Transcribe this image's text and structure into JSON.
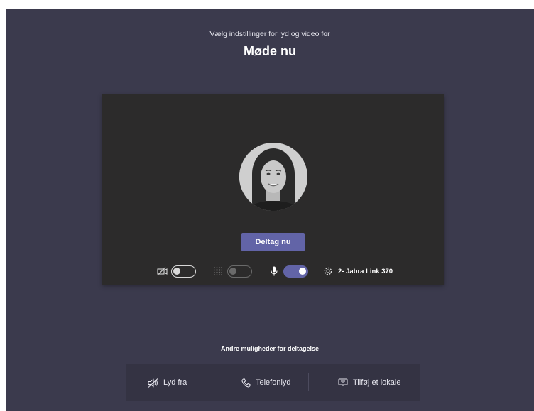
{
  "header": {
    "subtitle": "Vælg indstillinger for lyd og video for",
    "title": "Møde nu"
  },
  "preview": {
    "join_label": "Deltag nu",
    "controls": {
      "camera": {
        "icon": "camera-off-icon",
        "state": "off"
      },
      "background_blur": {
        "icon": "blur-icon",
        "state": "disabled"
      },
      "microphone": {
        "icon": "microphone-icon",
        "state": "on"
      },
      "device_settings": {
        "icon": "gear-icon",
        "label": "2- Jabra Link 370"
      }
    }
  },
  "other_options": {
    "heading": "Andre muligheder for deltagelse",
    "items": [
      {
        "icon": "speaker-off-icon",
        "label": "Lyd fra"
      },
      {
        "icon": "phone-icon",
        "label": "Telefonlyd"
      },
      {
        "icon": "room-share-icon",
        "label": "Tilføj et lokale"
      }
    ]
  },
  "colors": {
    "background": "#3b3a4d",
    "preview_background": "#2c2b2b",
    "accent": "#6264a7",
    "options_bar": "#343343"
  }
}
